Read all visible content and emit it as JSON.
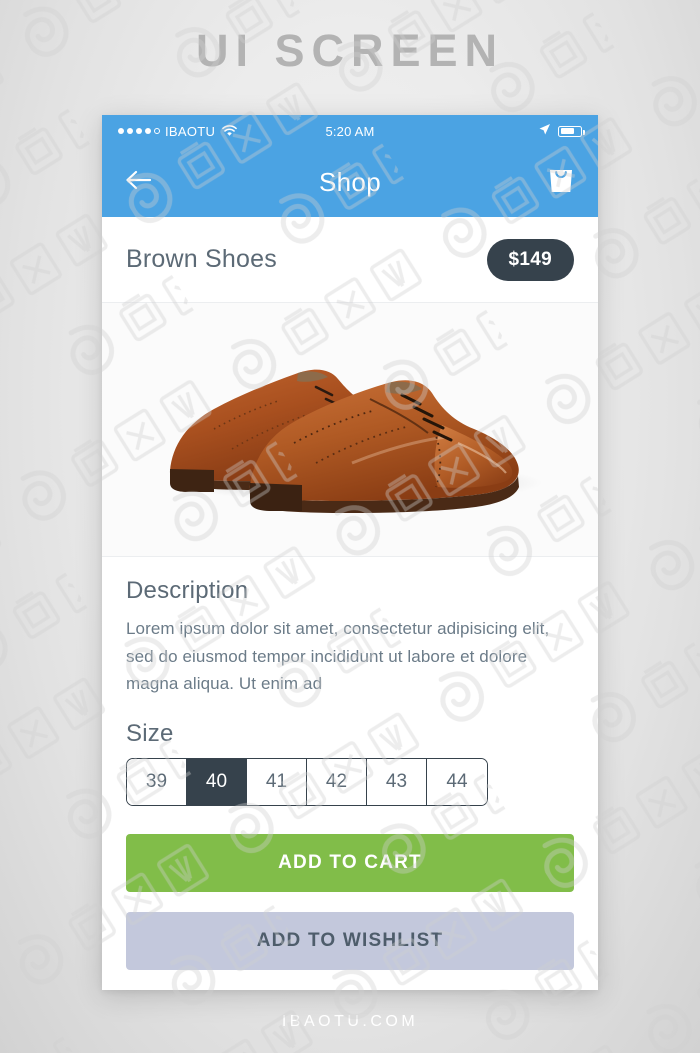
{
  "page": {
    "heading": "UI SCREEN",
    "footer": "IBAOTU.COM",
    "watermark_text": "包图网",
    "background_color": "#e8e8e8"
  },
  "colors": {
    "accent_blue": "#4ba3e3",
    "dark_slate": "#36424c",
    "cart_green": "#81bd49",
    "wishlist_grey": "#c3c8dc",
    "text_muted": "#5c6a76"
  },
  "statusbar": {
    "signal_dots_filled": 4,
    "signal_dots_total": 5,
    "carrier": "IBAOTU",
    "wifi_icon": "wifi-icon",
    "time": "5:20 AM",
    "location_icon": "location-arrow-icon",
    "battery_icon": "battery-icon",
    "battery_level_percent": 72
  },
  "navbar": {
    "back_icon": "arrow-left-icon",
    "title": "Shop",
    "cart_icon": "shopping-bag-icon"
  },
  "product": {
    "name": "Brown Shoes",
    "price": "$149",
    "image_alt": "brown-leather-oxford-shoes"
  },
  "description": {
    "heading": "Description",
    "body": "Lorem ipsum dolor sit amet, consectetur adipisicing elit, sed do eiusmod tempor incididunt ut labore et dolore magna aliqua. Ut enim ad"
  },
  "size": {
    "heading": "Size",
    "options": [
      "39",
      "40",
      "41",
      "42",
      "43",
      "44"
    ],
    "selected": "40"
  },
  "actions": {
    "add_to_cart": "ADD TO CART",
    "add_to_wishlist": "ADD TO WISHLIST"
  }
}
